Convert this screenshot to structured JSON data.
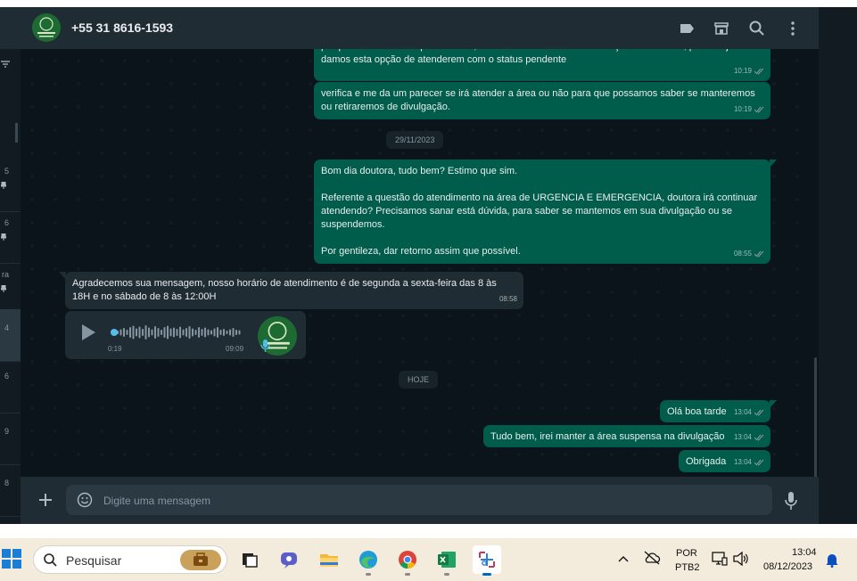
{
  "chat": {
    "contact_name": "+55 31 8616-1593",
    "header_icons": [
      "label-icon",
      "catalog-icon",
      "search-icon",
      "menu-icon"
    ],
    "left_list_times": [
      "5",
      "6",
      "ra",
      "4",
      "6",
      "9",
      "8"
    ],
    "messages": [
      {
        "text": "porque é desta forma que atuamos, não temos como solicitar liberação de imediato, por isso já\ndamos esta opção de atenderem com o status pendente",
        "time": "10:19"
      },
      {
        "text": "verifica e me da um parecer se irá atender a área ou não para que possamos saber se manteremos\nou retiraremos de divulgação.",
        "time": "10:19"
      },
      {
        "text": "Bom dia doutora, tudo bem? Estimo que sim.\n\nReferente a questão do atendimento na área de URGENCIA E EMERGENCIA, doutora irá continuar\natendendo? Precisamos sanar está dúvida, para saber se mantemos em sua divulgação ou se\nsuspendemos.\n\nPor gentileza, dar retorno assim que possível.",
        "time": "08:55"
      },
      {
        "text": "Agradecemos sua mensagem, nosso horário de atendimento é de segunda a sexta-feira das 8 às\n18H e no sábado de 8 às 12:00H",
        "time": "08:58"
      },
      {
        "text": "Olá boa tarde",
        "time": "13:04"
      },
      {
        "text": "Tudo bem, irei manter a área suspensa na divulgação",
        "time": "13:04"
      },
      {
        "text": "Obrigada",
        "time": "13:04"
      }
    ],
    "date_separators": [
      "29/11/2023",
      "HOJE"
    ],
    "audio": {
      "duration": "0:19",
      "time": "09:09",
      "progress": 0.0
    },
    "composer_placeholder": "Digite uma mensagem"
  },
  "taskbar": {
    "search_placeholder": "Pesquisar",
    "apps": [
      "task-view",
      "meet",
      "file-explorer",
      "edge",
      "chrome",
      "excel",
      "snipping-tool"
    ],
    "language_line1": "POR",
    "language_line2": "PTB2",
    "clock_time": "13:04",
    "clock_date": "08/12/2023"
  },
  "colors": {
    "outgoing_bubble": "#005c4b",
    "incoming_bubble": "#202c33",
    "background": "#0b141a",
    "header": "#202c33",
    "read_ticks": "#8696a0"
  }
}
